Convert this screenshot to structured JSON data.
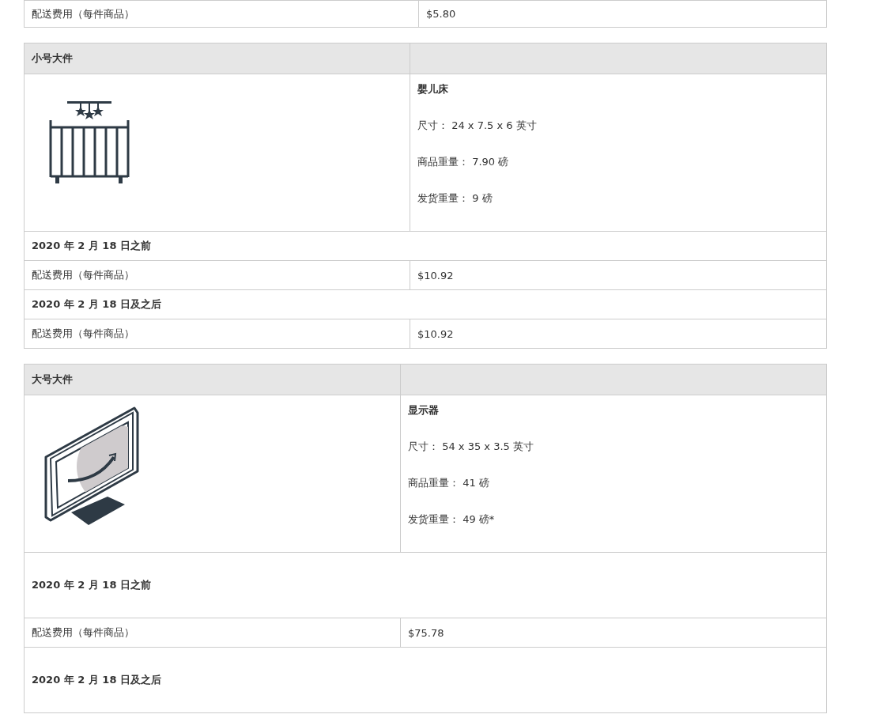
{
  "tables": [
    {
      "rows": [
        {
          "kind": "fee",
          "label": "配送费用（每件商品）",
          "value": "$5.80"
        }
      ]
    },
    {
      "title": "小号大件",
      "product": {
        "kind": "crib",
        "name": "婴儿床",
        "specs": [
          "尺寸： 24 x 7.5 x 6 英寸",
          "商品重量： 7.90 磅",
          "发货重量： 9 磅"
        ]
      },
      "rows": [
        {
          "kind": "date",
          "label": "2020 年 2 月 18 日之前"
        },
        {
          "kind": "fee",
          "label": "配送费用（每件商品）",
          "value": "$10.92"
        },
        {
          "kind": "date",
          "label": "2020 年 2 月 18 日及之后"
        },
        {
          "kind": "fee",
          "label": "配送费用（每件商品）",
          "value": "$10.92"
        }
      ]
    },
    {
      "title": "大号大件",
      "product": {
        "kind": "monitor",
        "name": "显示器",
        "specs": [
          "尺寸： 54 x 35 x 3.5 英寸",
          "商品重量： 41 磅",
          "发货重量： 49 磅*"
        ]
      },
      "rows": [
        {
          "kind": "date",
          "label": "2020 年 2 月 18 日之前"
        },
        {
          "kind": "fee",
          "label": "配送费用（每件商品）",
          "value": "$75.78"
        },
        {
          "kind": "date",
          "label": "2020 年 2 月 18 日及之后"
        }
      ]
    }
  ]
}
